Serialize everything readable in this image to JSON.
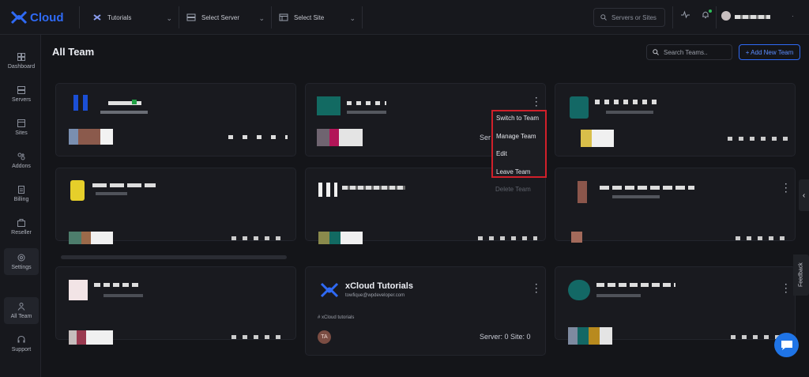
{
  "app": {
    "name": "Cloud",
    "brand_color": "#2f6af5"
  },
  "header": {
    "tutorials_selector": "Tutorials",
    "server_selector": "Select Server",
    "site_selector": "Select Site",
    "search_placeholder": "Servers or Sites",
    "icons": [
      "activity-icon",
      "bell-icon",
      "avatar"
    ]
  },
  "sidebar": {
    "items": [
      {
        "label": "Dashboard",
        "icon": "dashboard-icon"
      },
      {
        "label": "Servers",
        "icon": "server-icon"
      },
      {
        "label": "Sites",
        "icon": "sites-icon"
      },
      {
        "label": "Addons",
        "icon": "addons-icon"
      },
      {
        "label": "Billing",
        "icon": "billing-icon"
      },
      {
        "label": "Reseller",
        "icon": "reseller-icon"
      },
      {
        "label": "Settings",
        "icon": "settings-icon"
      },
      {
        "label": "All Team",
        "icon": "team-icon"
      },
      {
        "label": "Support",
        "icon": "support-icon"
      }
    ]
  },
  "page": {
    "title": "All Team",
    "search_placeholder": "Search Teams..",
    "add_button": "+ Add New Team"
  },
  "context_menu": {
    "items": [
      "Switch to Team",
      "Manage Team",
      "Edit",
      "Leave Team"
    ],
    "disabled_item": "Delete Team",
    "partial_label": "Ser"
  },
  "team_card": {
    "name": "xCloud Tutorials",
    "email": "towfique@wpdeveloper.com",
    "description": "# xCloud tutorials",
    "avatar_initials": "TA",
    "stats": "Server: 0  Site: 0"
  },
  "feedback": "Feedback",
  "colors": {
    "menu_outline": "#d1202a",
    "accent": "#2f6af5",
    "chat": "#1f74e6"
  }
}
